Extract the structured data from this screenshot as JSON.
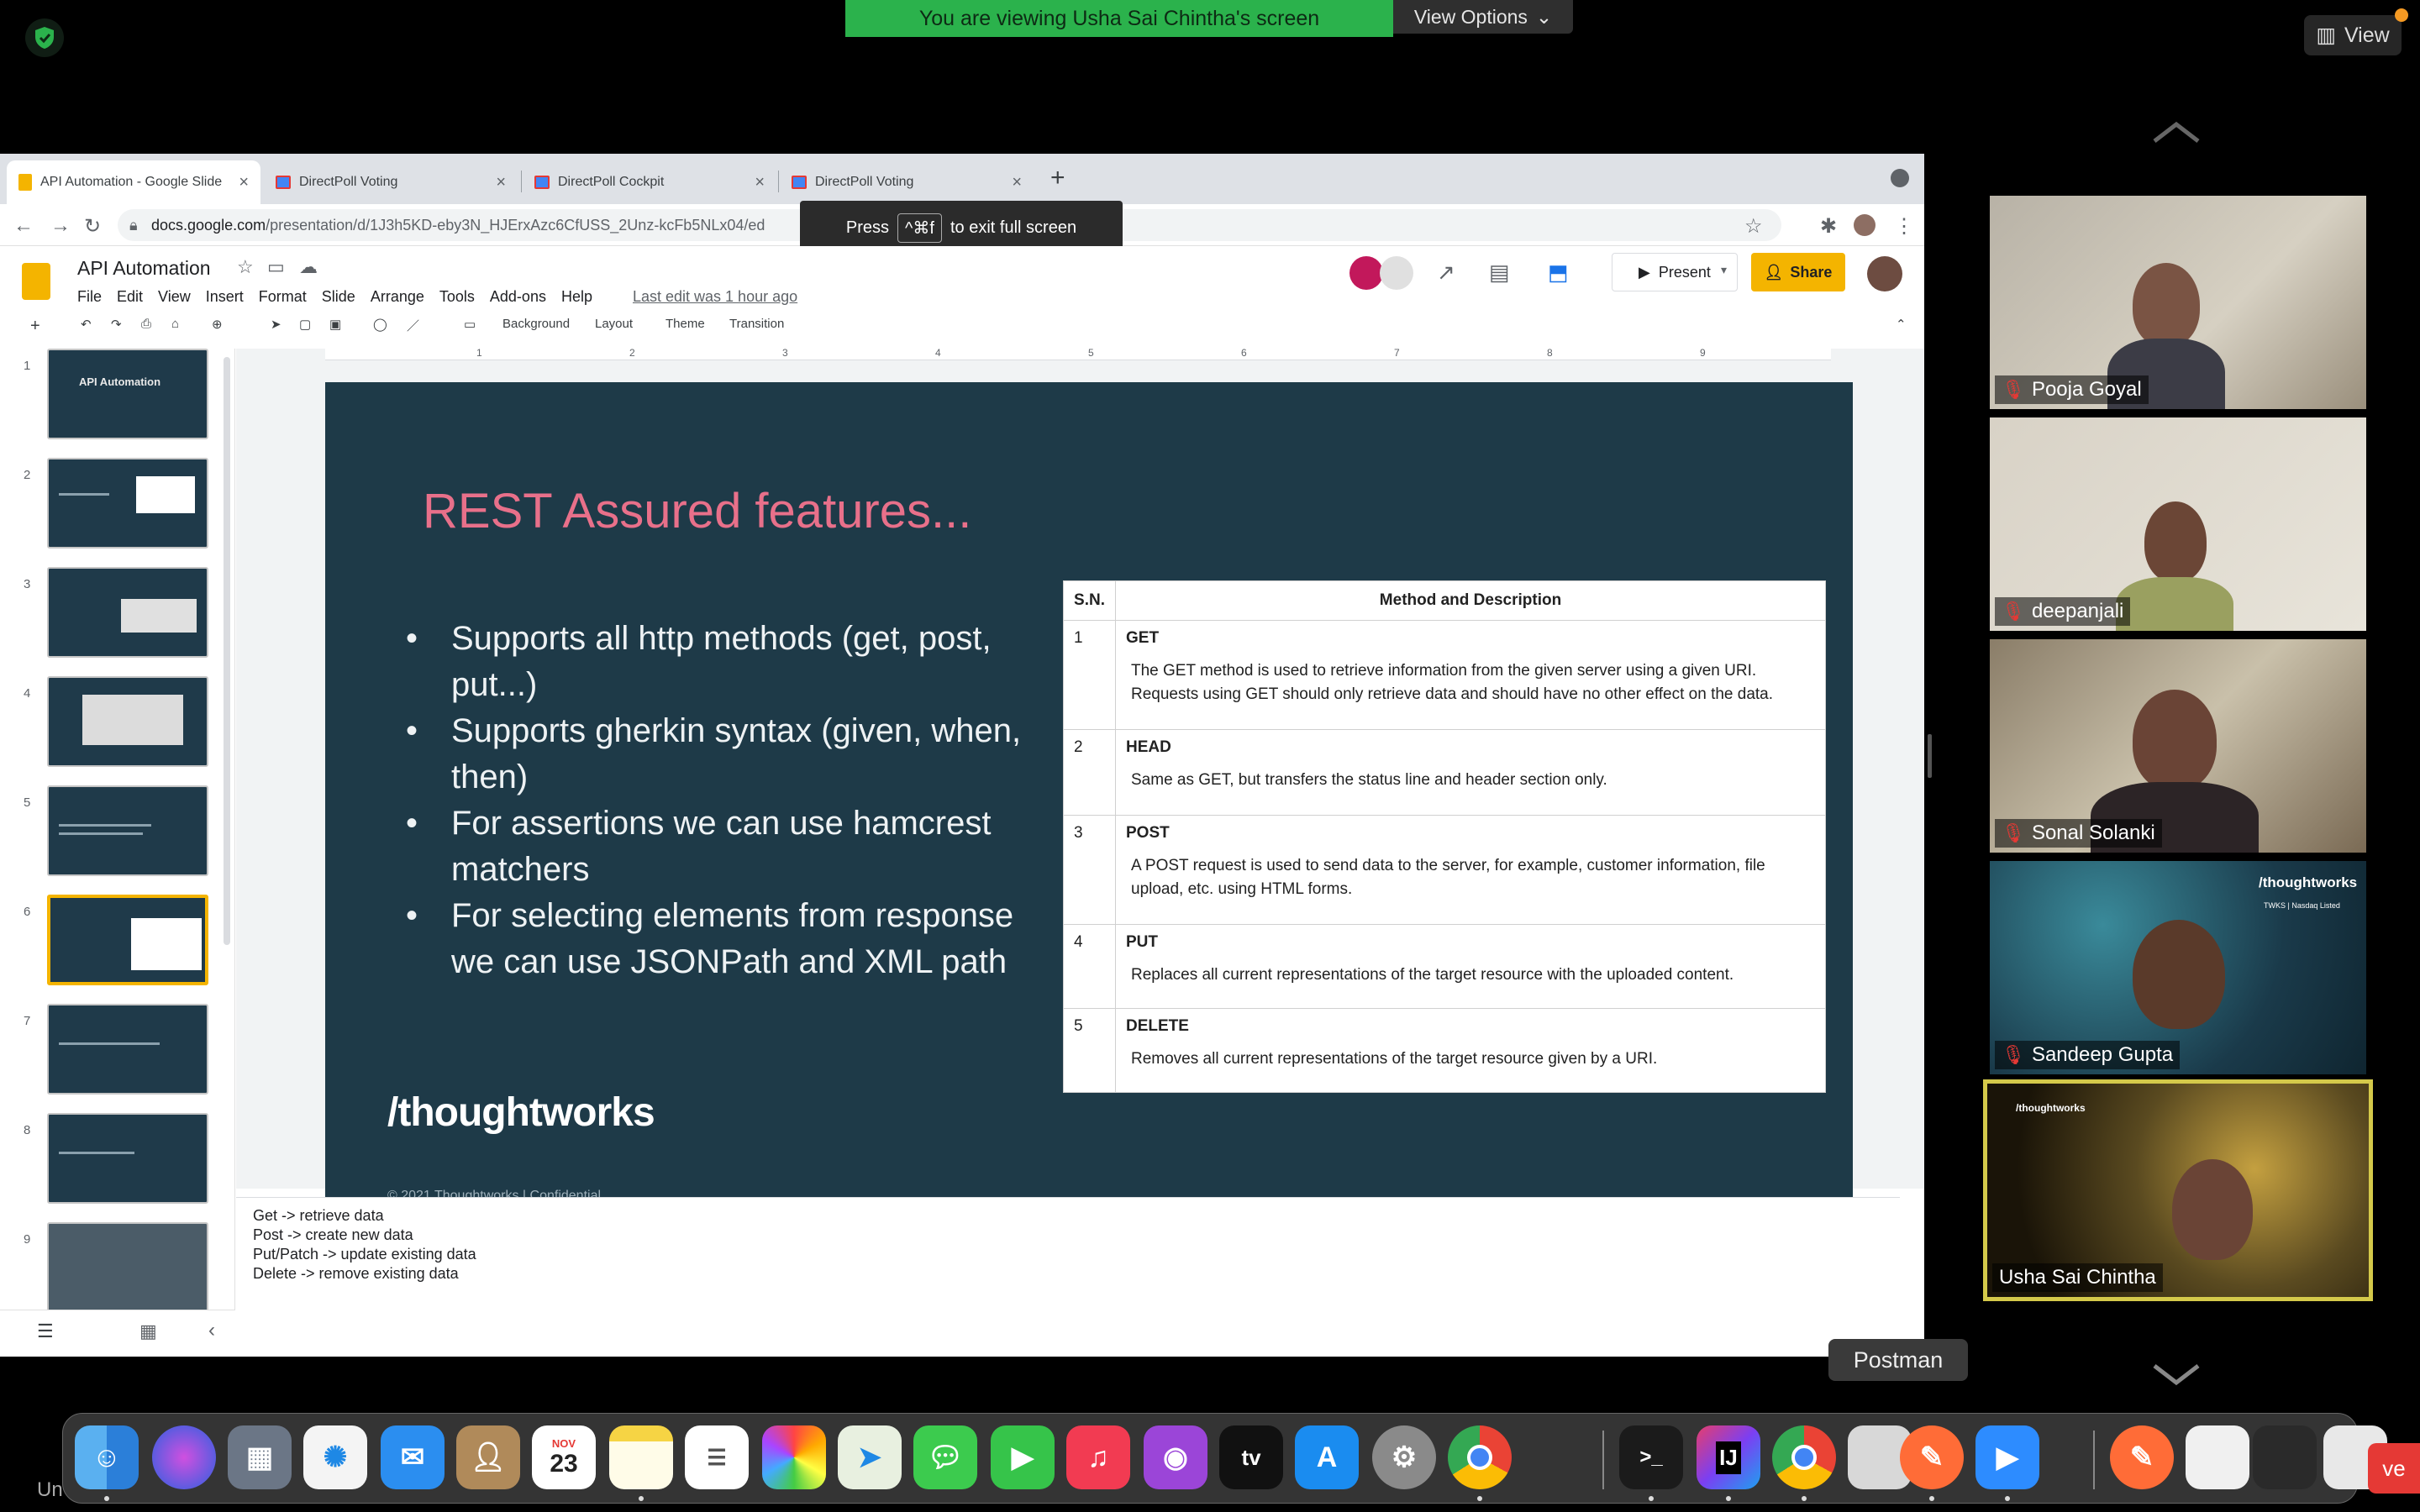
{
  "zoom": {
    "banner": "You are viewing Usha Sai Chintha's screen",
    "view_options": "View Options",
    "view_button": "View"
  },
  "browser": {
    "tabs": [
      {
        "label": "API Automation - Google Slide",
        "icon": "slides-favicon"
      },
      {
        "label": "DirectPoll Voting",
        "icon": "directpoll-favicon"
      },
      {
        "label": "DirectPoll Cockpit",
        "icon": "directpoll-favicon"
      },
      {
        "label": "DirectPoll Voting",
        "icon": "directpoll-favicon"
      }
    ],
    "url_host": "docs.google.com",
    "url_path": "/presentation/d/1J3h5KD-eby3N_HJErxAzc6CfUSS_2Unz-kcFb5NLx04/ed",
    "fullscreen_toast": {
      "press": "Press",
      "key": "^⌘f",
      "rest": "to exit full screen"
    }
  },
  "docs": {
    "title": "API Automation",
    "menu": [
      "File",
      "Edit",
      "View",
      "Insert",
      "Format",
      "Slide",
      "Arrange",
      "Tools",
      "Add-ons",
      "Help"
    ],
    "last_edit": "Last edit was 1 hour ago",
    "present": "Present",
    "share": "Share",
    "toolbar": {
      "background": "Background",
      "layout": "Layout",
      "theme": "Theme",
      "transition": "Transition"
    },
    "ruler_numbers": [
      "1",
      "2",
      "3",
      "4",
      "5",
      "6",
      "7",
      "8",
      "9"
    ]
  },
  "thumbnails": [
    {
      "num": "1",
      "title": "API Automation"
    },
    {
      "num": "2",
      "title": ""
    },
    {
      "num": "3",
      "title": ""
    },
    {
      "num": "4",
      "title": ""
    },
    {
      "num": "5",
      "title": ""
    },
    {
      "num": "6",
      "title": ""
    },
    {
      "num": "7",
      "title": ""
    },
    {
      "num": "8",
      "title": ""
    },
    {
      "num": "9",
      "title": ""
    }
  ],
  "slide": {
    "title": "REST Assured features...",
    "bullets": [
      "Supports all http methods (get, post, put...)",
      "Supports gherkin syntax (given, when, then)",
      "For assertions we can use hamcrest matchers",
      "For selecting elements from response we can use JSONPath and XML path"
    ],
    "logo": "/thoughtworks",
    "footer": "© 2021 Thoughtworks  |  Confidential",
    "table": {
      "headers": [
        "S.N.",
        "Method and Description"
      ],
      "rows": [
        {
          "sn": "1",
          "method": "GET",
          "desc": "The GET method is used to retrieve information from the given server using a given URI. Requests using GET should only retrieve data and should have no other effect on the data."
        },
        {
          "sn": "2",
          "method": "HEAD",
          "desc": "Same as GET, but transfers the status line and header section only."
        },
        {
          "sn": "3",
          "method": "POST",
          "desc": "A POST request is used to send data to the server, for example, customer information, file upload, etc. using HTML forms."
        },
        {
          "sn": "4",
          "method": "PUT",
          "desc": "Replaces all current representations of the target resource with the uploaded content."
        },
        {
          "sn": "5",
          "method": "DELETE",
          "desc": "Removes all current representations of the target resource given by a URI."
        }
      ]
    }
  },
  "notes": [
    "Get -> retrieve data",
    "Post -> create new data",
    "Put/Patch -> update existing data",
    "Delete -> remove existing data"
  ],
  "participants": [
    {
      "name": "Pooja Goyal",
      "muted": true
    },
    {
      "name": "deepanjali",
      "muted": true
    },
    {
      "name": "Sonal Solanki",
      "muted": true
    },
    {
      "name": "Sandeep Gupta",
      "muted": true,
      "badge": "/thoughtworks",
      "badge_sub": "TWKS | Nasdaq Listed"
    },
    {
      "name": "Usha Sai Chintha",
      "muted": false,
      "badge": "/thoughtworks"
    }
  ],
  "dock": {
    "tooltip": "Postman",
    "calendar_month": "NOV",
    "calendar_day": "23",
    "tv_label": "tv",
    "intellij_label": "IJ",
    "terminal_label": ">_",
    "red_button": "ve",
    "bottom_left_text": "Un"
  },
  "colors": {
    "banner_green": "#2bb24c",
    "slide_bg": "#1e3a48",
    "slide_title": "#e8708a",
    "share_yellow": "#f4b400",
    "speaking_border": "#d4c94a"
  }
}
